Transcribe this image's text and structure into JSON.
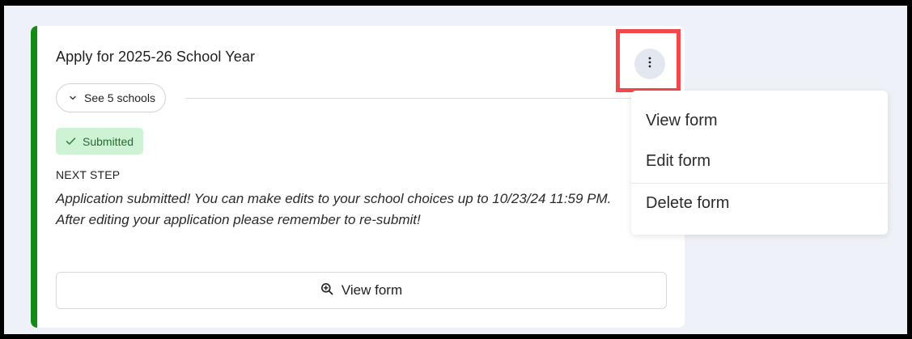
{
  "card": {
    "title": "Apply for 2025-26 School Year",
    "schools_toggle_label": "See 5 schools",
    "status_label": "Submitted",
    "next_step_label": "NEXT STEP",
    "next_step_text": "Application submitted! You can make edits to your school choices up to 10/23/24 11:59 PM. After editing your application please remember to re-submit!",
    "view_form_label": "View form",
    "accent_color": "#148a17"
  },
  "menu": {
    "items": [
      {
        "label": "View form"
      },
      {
        "label": "Edit form"
      },
      {
        "label": "Delete form"
      }
    ],
    "highlight_color": "#f2474b"
  },
  "icons": {
    "schools_toggle": "chevron-down-icon",
    "status": "check-icon",
    "view_form": "zoom-in-icon",
    "menu": "more-vertical-icon"
  }
}
